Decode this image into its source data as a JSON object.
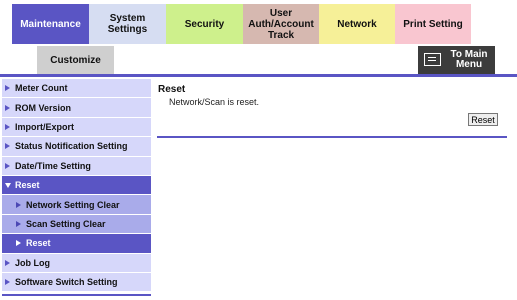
{
  "tabs": {
    "maintenance": "Maintenance",
    "system_settings": "System Settings",
    "security": "Security",
    "user_auth": "User Auth/Account Track",
    "network": "Network",
    "print_setting": "Print Setting",
    "customize": "Customize"
  },
  "main_menu_button": {
    "label": "To Main Menu",
    "icon": "main-menu-icon"
  },
  "sidebar": {
    "items": [
      {
        "label": "Meter Count"
      },
      {
        "label": "ROM Version"
      },
      {
        "label": "Import/Export"
      },
      {
        "label": "Status Notification Setting"
      },
      {
        "label": "Date/Time Setting"
      },
      {
        "label": "Reset"
      },
      {
        "label": "Network Setting Clear"
      },
      {
        "label": "Scan Setting Clear"
      },
      {
        "label": "Reset"
      },
      {
        "label": "Job Log"
      },
      {
        "label": "Software Switch Setting"
      }
    ]
  },
  "content": {
    "title": "Reset",
    "message": "Network/Scan is reset.",
    "reset_button": "Reset"
  },
  "colors": {
    "accent": "#5a55c4",
    "sidebar_bg": "#d6d7fa",
    "sidebar_sub_bg": "#a9abea"
  }
}
